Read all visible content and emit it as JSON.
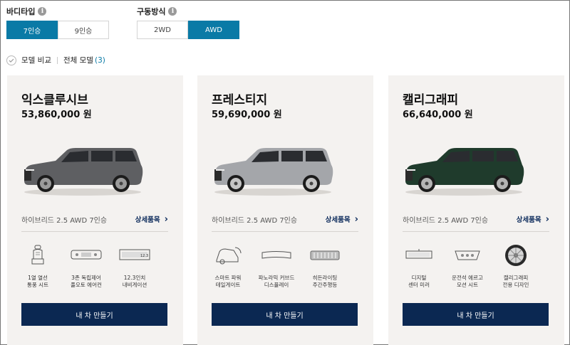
{
  "filters": {
    "body_type": {
      "title": "바디타입",
      "options": [
        "7인승",
        "9인승"
      ],
      "selected": "7인승"
    },
    "drive": {
      "title": "구동방식",
      "options": [
        "2WD",
        "AWD"
      ],
      "selected": "AWD"
    }
  },
  "compare": {
    "label": "모델 비교",
    "all_label": "전체 모델",
    "count": "(3)"
  },
  "models": [
    {
      "name": "익스클루시브",
      "price": "53,860,000 원",
      "trim": "하이브리드 2.5 AWD 7인승",
      "detail_label": "상세품목",
      "car_color": "#5e5f62",
      "wheel_color": "#9b9b9b",
      "features": [
        {
          "icon": "seat-icon",
          "line1": "1열 열선",
          "line2": "통풍 시트"
        },
        {
          "icon": "climate-panel-icon",
          "line1": "3존 독립제어",
          "line2": "풀오토 에어컨"
        },
        {
          "icon": "navigation-display-icon",
          "line1": "12.3인치",
          "line2": "내비게이션"
        }
      ],
      "button_label": "내 차 만들기"
    },
    {
      "name": "프레스티지",
      "price": "59,690,000 원",
      "trim": "하이브리드 2.5 AWD 7인승",
      "detail_label": "상세품목",
      "car_color": "#a4a6aa",
      "wheel_color": "#c4c4c4",
      "features": [
        {
          "icon": "power-tailgate-icon",
          "line1": "스마트 파워",
          "line2": "테일게이트"
        },
        {
          "icon": "panoramic-curved-display-icon",
          "line1": "파노라믹 커브드",
          "line2": "디스플레이"
        },
        {
          "icon": "highway-driving-assist-icon",
          "line1": "히든라이팅",
          "line2": "주간주행등"
        }
      ],
      "button_label": "내 차 만들기"
    },
    {
      "name": "캘리그래피",
      "price": "66,640,000 원",
      "trim": "하이브리드 2.5 AWD 7인승",
      "detail_label": "상세품목",
      "car_color": "#1f3b2c",
      "wheel_color": "#b4b4b4",
      "features": [
        {
          "icon": "digital-center-mirror-icon",
          "line1": "디지털",
          "line2": "센터 미러"
        },
        {
          "icon": "ergo-motion-seat-icon",
          "line1": "운전석 에르고",
          "line2": "모션 시트"
        },
        {
          "icon": "calligraphy-wheel-icon",
          "line1": "캘리그래피",
          "line2": "전용 디자인"
        }
      ],
      "button_label": "내 차 만들기"
    }
  ]
}
